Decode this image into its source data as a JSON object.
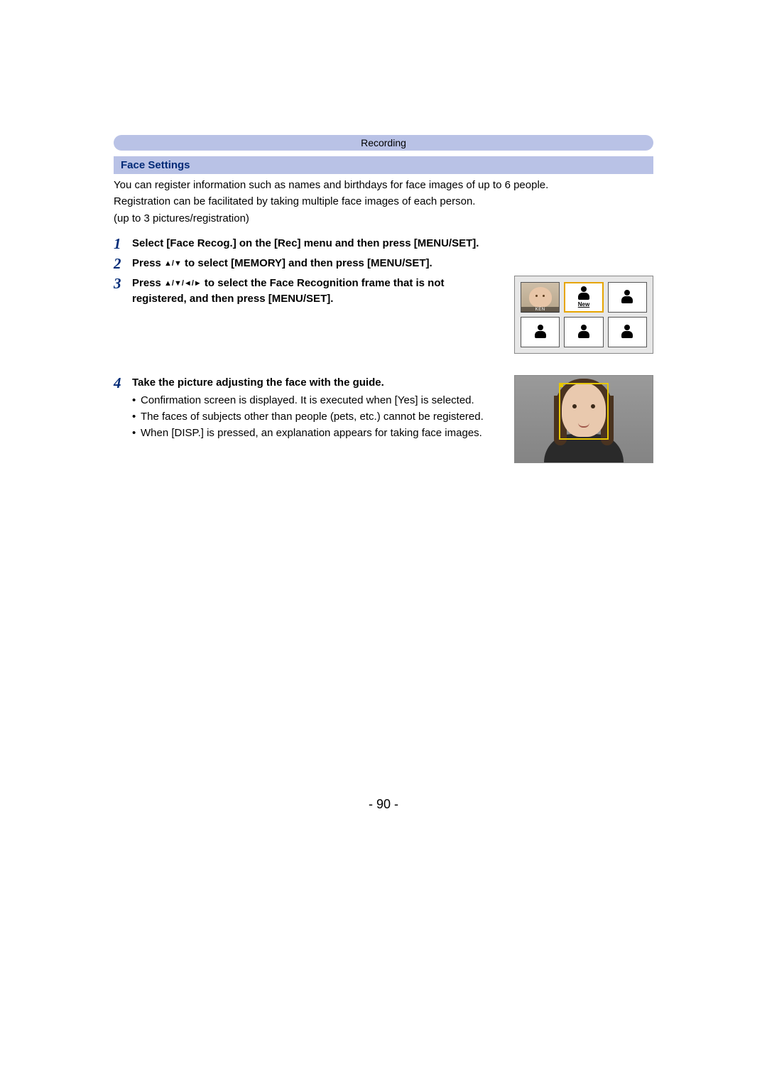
{
  "breadcrumb": "Recording",
  "section_title": "Face Settings",
  "intro": {
    "line1": "You can register information such as names and birthdays for face images of up to 6 people.",
    "line2": "Registration can be facilitated by taking multiple face images of each person.",
    "line3": "(up to 3 pictures/registration)"
  },
  "steps": {
    "s1": {
      "num": "1",
      "title": "Select [Face Recog.] on the [Rec] menu and then press [MENU/SET]."
    },
    "s2": {
      "num": "2",
      "title_pre": "Press ",
      "title_post": " to select [MEMORY] and then press [MENU/SET]."
    },
    "s3": {
      "num": "3",
      "title_pre": "Press ",
      "title_post": " to select the Face Recognition frame that is not registered, and then press [MENU/SET]."
    },
    "s4": {
      "num": "4",
      "title": "Take the picture adjusting the face with the guide.",
      "b1": "Confirmation screen is displayed. It is executed when [Yes] is selected.",
      "b2": "The faces of subjects other than people (pets, etc.) cannot be registered.",
      "b3": "When [DISP.] is pressed, an explanation appears for taking face images."
    }
  },
  "grid": {
    "name": "KEN",
    "new_label": "New"
  },
  "arrows": {
    "ud": "▲/▼",
    "udlr": "▲/▼/◄/►"
  },
  "page_number": "- 90 -"
}
